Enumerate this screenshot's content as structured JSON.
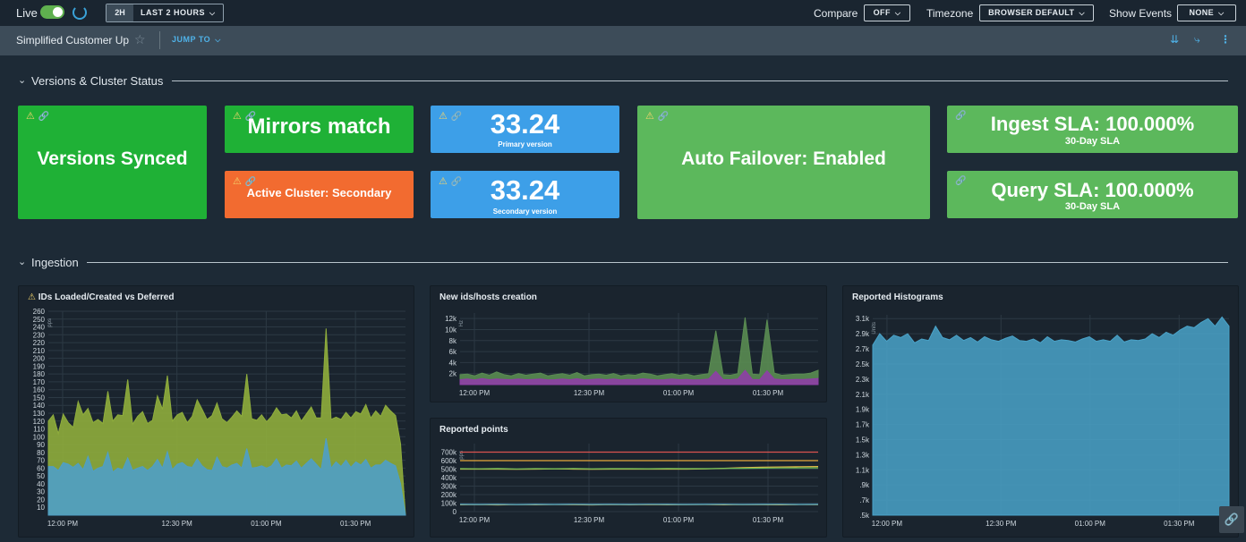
{
  "topbar": {
    "live_label": "Live",
    "range_short": "2H",
    "range_label": "LAST 2 HOURS",
    "compare_label": "Compare",
    "compare_value": "OFF",
    "timezone_label": "Timezone",
    "timezone_value": "BROWSER DEFAULT",
    "events_label": "Show Events",
    "events_value": "NONE"
  },
  "titlebar": {
    "title": "Simplified Customer Up",
    "jump_to": "JUMP TO"
  },
  "sections": {
    "versions": "Versions & Cluster Status",
    "ingestion": "Ingestion"
  },
  "tiles": {
    "versions_synced": "Versions Synced",
    "mirrors_match": "Mirrors match",
    "active_cluster": "Active Cluster: Secondary",
    "primary_value": "33.24",
    "primary_label": "Primary version",
    "secondary_value": "33.24",
    "secondary_label": "Secondary version",
    "auto_failover": "Auto Failover: Enabled",
    "ingest_sla": "Ingest SLA: 100.000%",
    "ingest_sub": "30-Day SLA",
    "query_sla": "Query SLA: 100.000%",
    "query_sub": "30-Day SLA"
  },
  "colors": {
    "bright_green": "#1fb136",
    "soft_green": "#5cb85c",
    "orange": "#f26b30",
    "blue": "#3d9fe8"
  },
  "chart_data": [
    {
      "type": "area",
      "title": "IDs Loaded/Created vs Deferred",
      "ylabel": "pps",
      "ylim": [
        0,
        260
      ],
      "yticks": [
        10,
        20,
        30,
        40,
        50,
        60,
        70,
        80,
        90,
        100,
        110,
        120,
        130,
        140,
        150,
        160,
        170,
        180,
        190,
        200,
        210,
        220,
        230,
        240,
        250,
        260
      ],
      "xticks": [
        "12:00 PM",
        "12:30 PM",
        "01:00 PM",
        "01:30 PM"
      ],
      "series": [
        {
          "color": "#8fad3c",
          "values": [
            120,
            128,
            104,
            129,
            118,
            112,
            145,
            128,
            136,
            118,
            122,
            117,
            158,
            120,
            128,
            127,
            173,
            116,
            126,
            132,
            117,
            121,
            152,
            135,
            178,
            120,
            128,
            131,
            118,
            126,
            147,
            135,
            122,
            127,
            143,
            123,
            118,
            125,
            133,
            126,
            180,
            123,
            121,
            128,
            119,
            126,
            137,
            128,
            129,
            124,
            133,
            120,
            129,
            138,
            124,
            124,
            238,
            122,
            125,
            122,
            131,
            124,
            132,
            129,
            141,
            124,
            133,
            126,
            140,
            133,
            127,
            91,
            0
          ]
        },
        {
          "color": "#4f9fc6",
          "values": [
            62,
            62,
            57,
            67,
            65,
            61,
            66,
            58,
            75,
            56,
            60,
            62,
            80,
            55,
            60,
            58,
            73,
            57,
            60,
            62,
            57,
            62,
            71,
            60,
            81,
            58,
            65,
            67,
            62,
            61,
            72,
            63,
            58,
            57,
            74,
            62,
            60,
            64,
            66,
            60,
            85,
            60,
            61,
            63,
            60,
            63,
            72,
            60,
            64,
            63,
            69,
            60,
            66,
            72,
            65,
            58,
            98,
            60,
            68,
            62,
            70,
            61,
            68,
            64,
            71,
            60,
            64,
            64,
            70,
            66,
            63,
            40,
            0
          ]
        }
      ]
    },
    {
      "type": "area",
      "title": "New ids/hosts creation",
      "ylabel": "Hz",
      "ylim": [
        0,
        13000
      ],
      "ytick_labels": [
        "12k",
        "10k",
        "8k",
        "6k",
        "4k",
        "2k"
      ],
      "xticks": [
        "12:00 PM",
        "12:30 PM",
        "01:00 PM",
        "01:30 PM"
      ],
      "series": [
        {
          "color": "#5a8c52",
          "values": [
            1800,
            1900,
            1600,
            2100,
            1700,
            2300,
            1800,
            1600,
            2000,
            1700,
            1900,
            2100,
            1600,
            1800,
            2000,
            1700,
            2200,
            1600,
            1800,
            1900,
            1700,
            2000,
            1600,
            1800,
            1700,
            2100,
            1900,
            1600,
            1800,
            2000,
            1700,
            1900,
            1600,
            1800,
            2000,
            9800,
            1800,
            1700,
            2000,
            12200,
            1900,
            1800,
            11800,
            2100,
            1700,
            1800,
            1900,
            1900,
            2100,
            2600
          ]
        },
        {
          "color": "#8e3fa6",
          "values": [
            900,
            1000,
            850,
            1100,
            900,
            1000,
            950,
            900,
            1000,
            900,
            950,
            1000,
            850,
            900,
            1000,
            900,
            1050,
            850,
            950,
            1000,
            900,
            1000,
            850,
            950,
            900,
            1050,
            950,
            850,
            900,
            1000,
            900,
            950,
            850,
            900,
            1000,
            2400,
            900,
            900,
            1000,
            2600,
            950,
            900,
            2500,
            1000,
            900,
            900,
            950,
            950,
            1000,
            1100
          ]
        }
      ]
    },
    {
      "type": "line",
      "title": "Reported points",
      "ylabel": "pps",
      "ylim": [
        0,
        800000
      ],
      "ytick_labels": [
        "700k",
        "600k",
        "500k",
        "400k",
        "300k",
        "200k",
        "100k",
        "0"
      ],
      "xticks": [
        "12:00 PM",
        "12:30 PM",
        "01:00 PM",
        "01:30 PM"
      ],
      "series": [
        {
          "color": "#d9534f",
          "values": [
            700000,
            700000,
            700000,
            700000,
            700000,
            700000,
            700000,
            700000,
            700000,
            700000,
            700000,
            700000,
            700000,
            700000,
            700000,
            700000,
            700000,
            700000,
            700000,
            700000
          ]
        },
        {
          "color": "#e8a93b",
          "values": [
            600000,
            600000,
            600000,
            600000,
            600000,
            600000,
            600000,
            600000,
            600000,
            600000,
            600000,
            600000,
            600000,
            600000,
            600000,
            600000,
            600000,
            600000,
            600000,
            600000
          ]
        },
        {
          "color": "#e0b648",
          "values": [
            500000,
            500000,
            500000,
            498000,
            500000,
            502000,
            500000,
            498000,
            500000,
            500000,
            500000,
            500000,
            500000,
            502000,
            510000,
            518000,
            522000,
            525000,
            528000,
            530000
          ]
        },
        {
          "color": "#6dbf57",
          "values": [
            505000,
            503000,
            506000,
            502000,
            505000,
            504000,
            506000,
            503000,
            505000,
            505000,
            504000,
            506000,
            505000,
            505000,
            508000,
            510000,
            512000,
            514000,
            515000,
            515000
          ]
        },
        {
          "color": "#d3b64b",
          "values": [
            80000,
            82000,
            79000,
            83000,
            80000,
            82000,
            81000,
            79000,
            82000,
            80000,
            83000,
            80000,
            81000,
            82000,
            80000,
            83000,
            81000,
            80000,
            82000,
            81000
          ]
        },
        {
          "color": "#4aa3c9",
          "values": [
            85000,
            84000,
            86000,
            83000,
            85000,
            84000,
            86000,
            84000,
            85000,
            84000,
            86000,
            85000,
            84000,
            85000,
            86000,
            84000,
            85000,
            86000,
            84000,
            85000
          ]
        }
      ]
    },
    {
      "type": "area",
      "title": "Reported Histograms",
      "ylabel": "Units",
      "ylim": [
        500,
        3150
      ],
      "ytick_labels": [
        "3.1k",
        "2.9k",
        "2.7k",
        "2.5k",
        "2.3k",
        "2.1k",
        "1.9k",
        "1.7k",
        "1.5k",
        "1.3k",
        "1.1k",
        ".9k",
        ".7k",
        ".5k"
      ],
      "xticks": [
        "12:00 PM",
        "12:30 PM",
        "01:00 PM",
        "01:30 PM"
      ],
      "series": [
        {
          "color": "#4aa3c9",
          "values": [
            2750,
            2900,
            2800,
            2880,
            2850,
            2900,
            2780,
            2830,
            2810,
            3000,
            2850,
            2820,
            2880,
            2810,
            2850,
            2790,
            2860,
            2820,
            2800,
            2840,
            2870,
            2810,
            2800,
            2830,
            2780,
            2860,
            2800,
            2820,
            2810,
            2790,
            2830,
            2860,
            2800,
            2820,
            2800,
            2880,
            2790,
            2820,
            2810,
            2830,
            2900,
            2850,
            2920,
            2880,
            2950,
            3000,
            2980,
            3050,
            3100,
            3000,
            3120,
            3000
          ]
        }
      ]
    }
  ]
}
